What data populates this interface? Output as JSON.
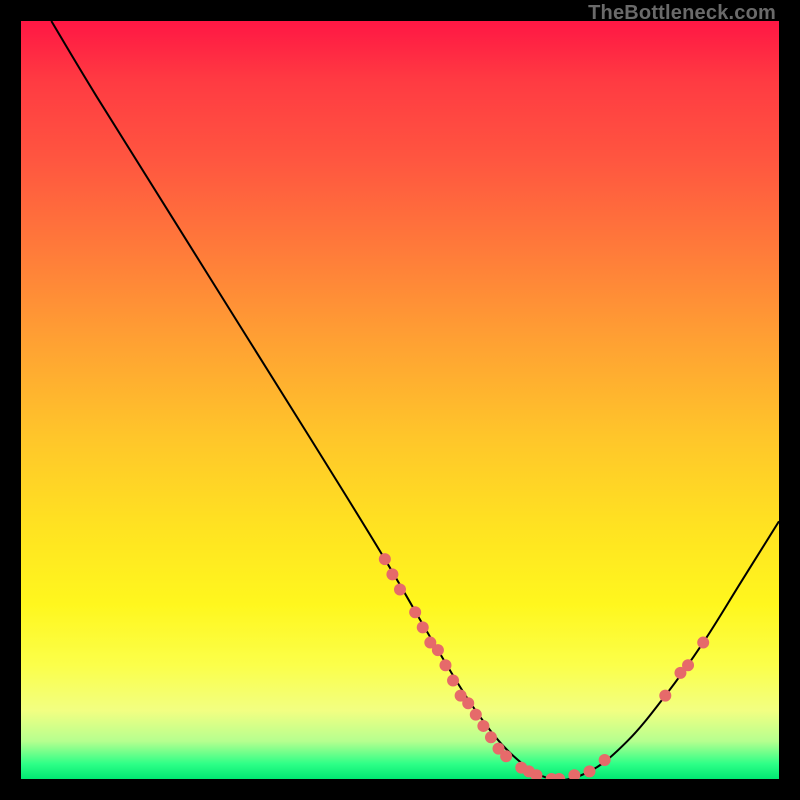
{
  "watermark": "TheBottleneck.com",
  "chart_data": {
    "type": "line",
    "title": "",
    "xlabel": "",
    "ylabel": "",
    "xlim": [
      0,
      100
    ],
    "ylim": [
      0,
      100
    ],
    "curve": [
      {
        "x": 4,
        "y": 100
      },
      {
        "x": 10,
        "y": 90
      },
      {
        "x": 20,
        "y": 74
      },
      {
        "x": 30,
        "y": 58
      },
      {
        "x": 40,
        "y": 42
      },
      {
        "x": 48,
        "y": 29
      },
      {
        "x": 55,
        "y": 17
      },
      {
        "x": 60,
        "y": 9
      },
      {
        "x": 65,
        "y": 3
      },
      {
        "x": 70,
        "y": 0
      },
      {
        "x": 75,
        "y": 1
      },
      {
        "x": 80,
        "y": 5
      },
      {
        "x": 85,
        "y": 11
      },
      {
        "x": 90,
        "y": 18
      },
      {
        "x": 95,
        "y": 26
      },
      {
        "x": 100,
        "y": 34
      }
    ],
    "points": [
      {
        "x": 48,
        "y": 29
      },
      {
        "x": 49,
        "y": 27
      },
      {
        "x": 50,
        "y": 25
      },
      {
        "x": 52,
        "y": 22
      },
      {
        "x": 53,
        "y": 20
      },
      {
        "x": 54,
        "y": 18
      },
      {
        "x": 55,
        "y": 17
      },
      {
        "x": 56,
        "y": 15
      },
      {
        "x": 57,
        "y": 13
      },
      {
        "x": 58,
        "y": 11
      },
      {
        "x": 59,
        "y": 10
      },
      {
        "x": 60,
        "y": 8.5
      },
      {
        "x": 61,
        "y": 7
      },
      {
        "x": 62,
        "y": 5.5
      },
      {
        "x": 63,
        "y": 4
      },
      {
        "x": 64,
        "y": 3
      },
      {
        "x": 66,
        "y": 1.5
      },
      {
        "x": 67,
        "y": 1
      },
      {
        "x": 68,
        "y": 0.5
      },
      {
        "x": 70,
        "y": 0
      },
      {
        "x": 71,
        "y": 0
      },
      {
        "x": 73,
        "y": 0.5
      },
      {
        "x": 75,
        "y": 1
      },
      {
        "x": 77,
        "y": 2.5
      },
      {
        "x": 85,
        "y": 11
      },
      {
        "x": 87,
        "y": 14
      },
      {
        "x": 88,
        "y": 15
      },
      {
        "x": 90,
        "y": 18
      }
    ],
    "point_color": "#e66a6a",
    "curve_color": "#000000"
  }
}
